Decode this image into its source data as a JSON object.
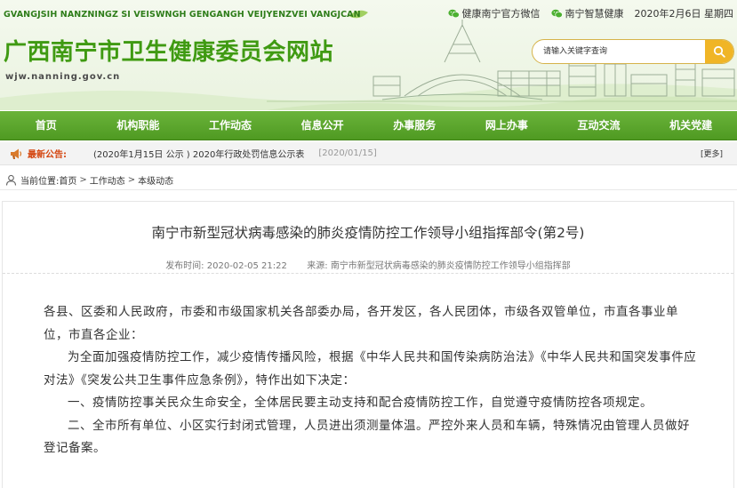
{
  "header": {
    "pinyin": "GVANGJSIH NANZNINGZ SI VEISWNGH GENGANGH VEIJYENZVEI VANGJCAN",
    "title": "广西南宁市卫生健康委员会网站",
    "domain": "wjw.nanning.gov.cn",
    "links": [
      {
        "label": "健康南宁官方微信",
        "icon": "wechat-icon"
      },
      {
        "label": "南宁智慧健康",
        "icon": "wechat-icon"
      }
    ],
    "date": "2020年2月6日 星期四",
    "search": {
      "placeholder": "请输入关键字查询",
      "icon": "search-icon"
    }
  },
  "nav": {
    "items": [
      "首页",
      "机构职能",
      "工作动态",
      "信息公开",
      "办事服务",
      "网上办事",
      "互动交流",
      "机关党建"
    ]
  },
  "notice": {
    "label": "最新公告:",
    "text": "(2020年1月15日 公示 ) 2020年行政处罚信息公示表",
    "date": "[2020/01/15]",
    "more": "[更多]"
  },
  "breadcrumb": {
    "label": "当前位置:",
    "items": [
      "首页",
      "工作动态",
      "本级动态"
    ]
  },
  "article": {
    "title": "南宁市新型冠状病毒感染的肺炎疫情防控工作领导小组指挥部令(第2号)",
    "publish_label": "发布时间:",
    "publish_time": "2020-02-05 21:22",
    "source_label": "来源:",
    "source": "南宁市新型冠状病毒感染的肺炎疫情防控工作领导小组指挥部",
    "paragraphs": [
      "各县、区委和人民政府，市委和市级国家机关各部委办局，各开发区，各人民团体，市级各双管单位，市直各事业单位，市直各企业：",
      "为全面加强疫情防控工作，减少疫情传播风险，根据《中华人民共和国传染病防治法》《中华人民共和国突发事件应对法》《突发公共卫生事件应急条例》，特作出如下决定：",
      "一、疫情防控事关民众生命安全，全体居民要主动支持和配合疫情防控工作，自觉遵守疫情防控各项规定。",
      "二、全市所有单位、小区实行封闭式管理，人员进出须测量体温。严控外来人员和车辆，特殊情况由管理人员做好登记备案。"
    ]
  },
  "colors": {
    "title_green": "#3f9a12",
    "nav_green": "#5aa52c",
    "notice_red": "#d4450f",
    "search_yellow": "#f0b526"
  }
}
